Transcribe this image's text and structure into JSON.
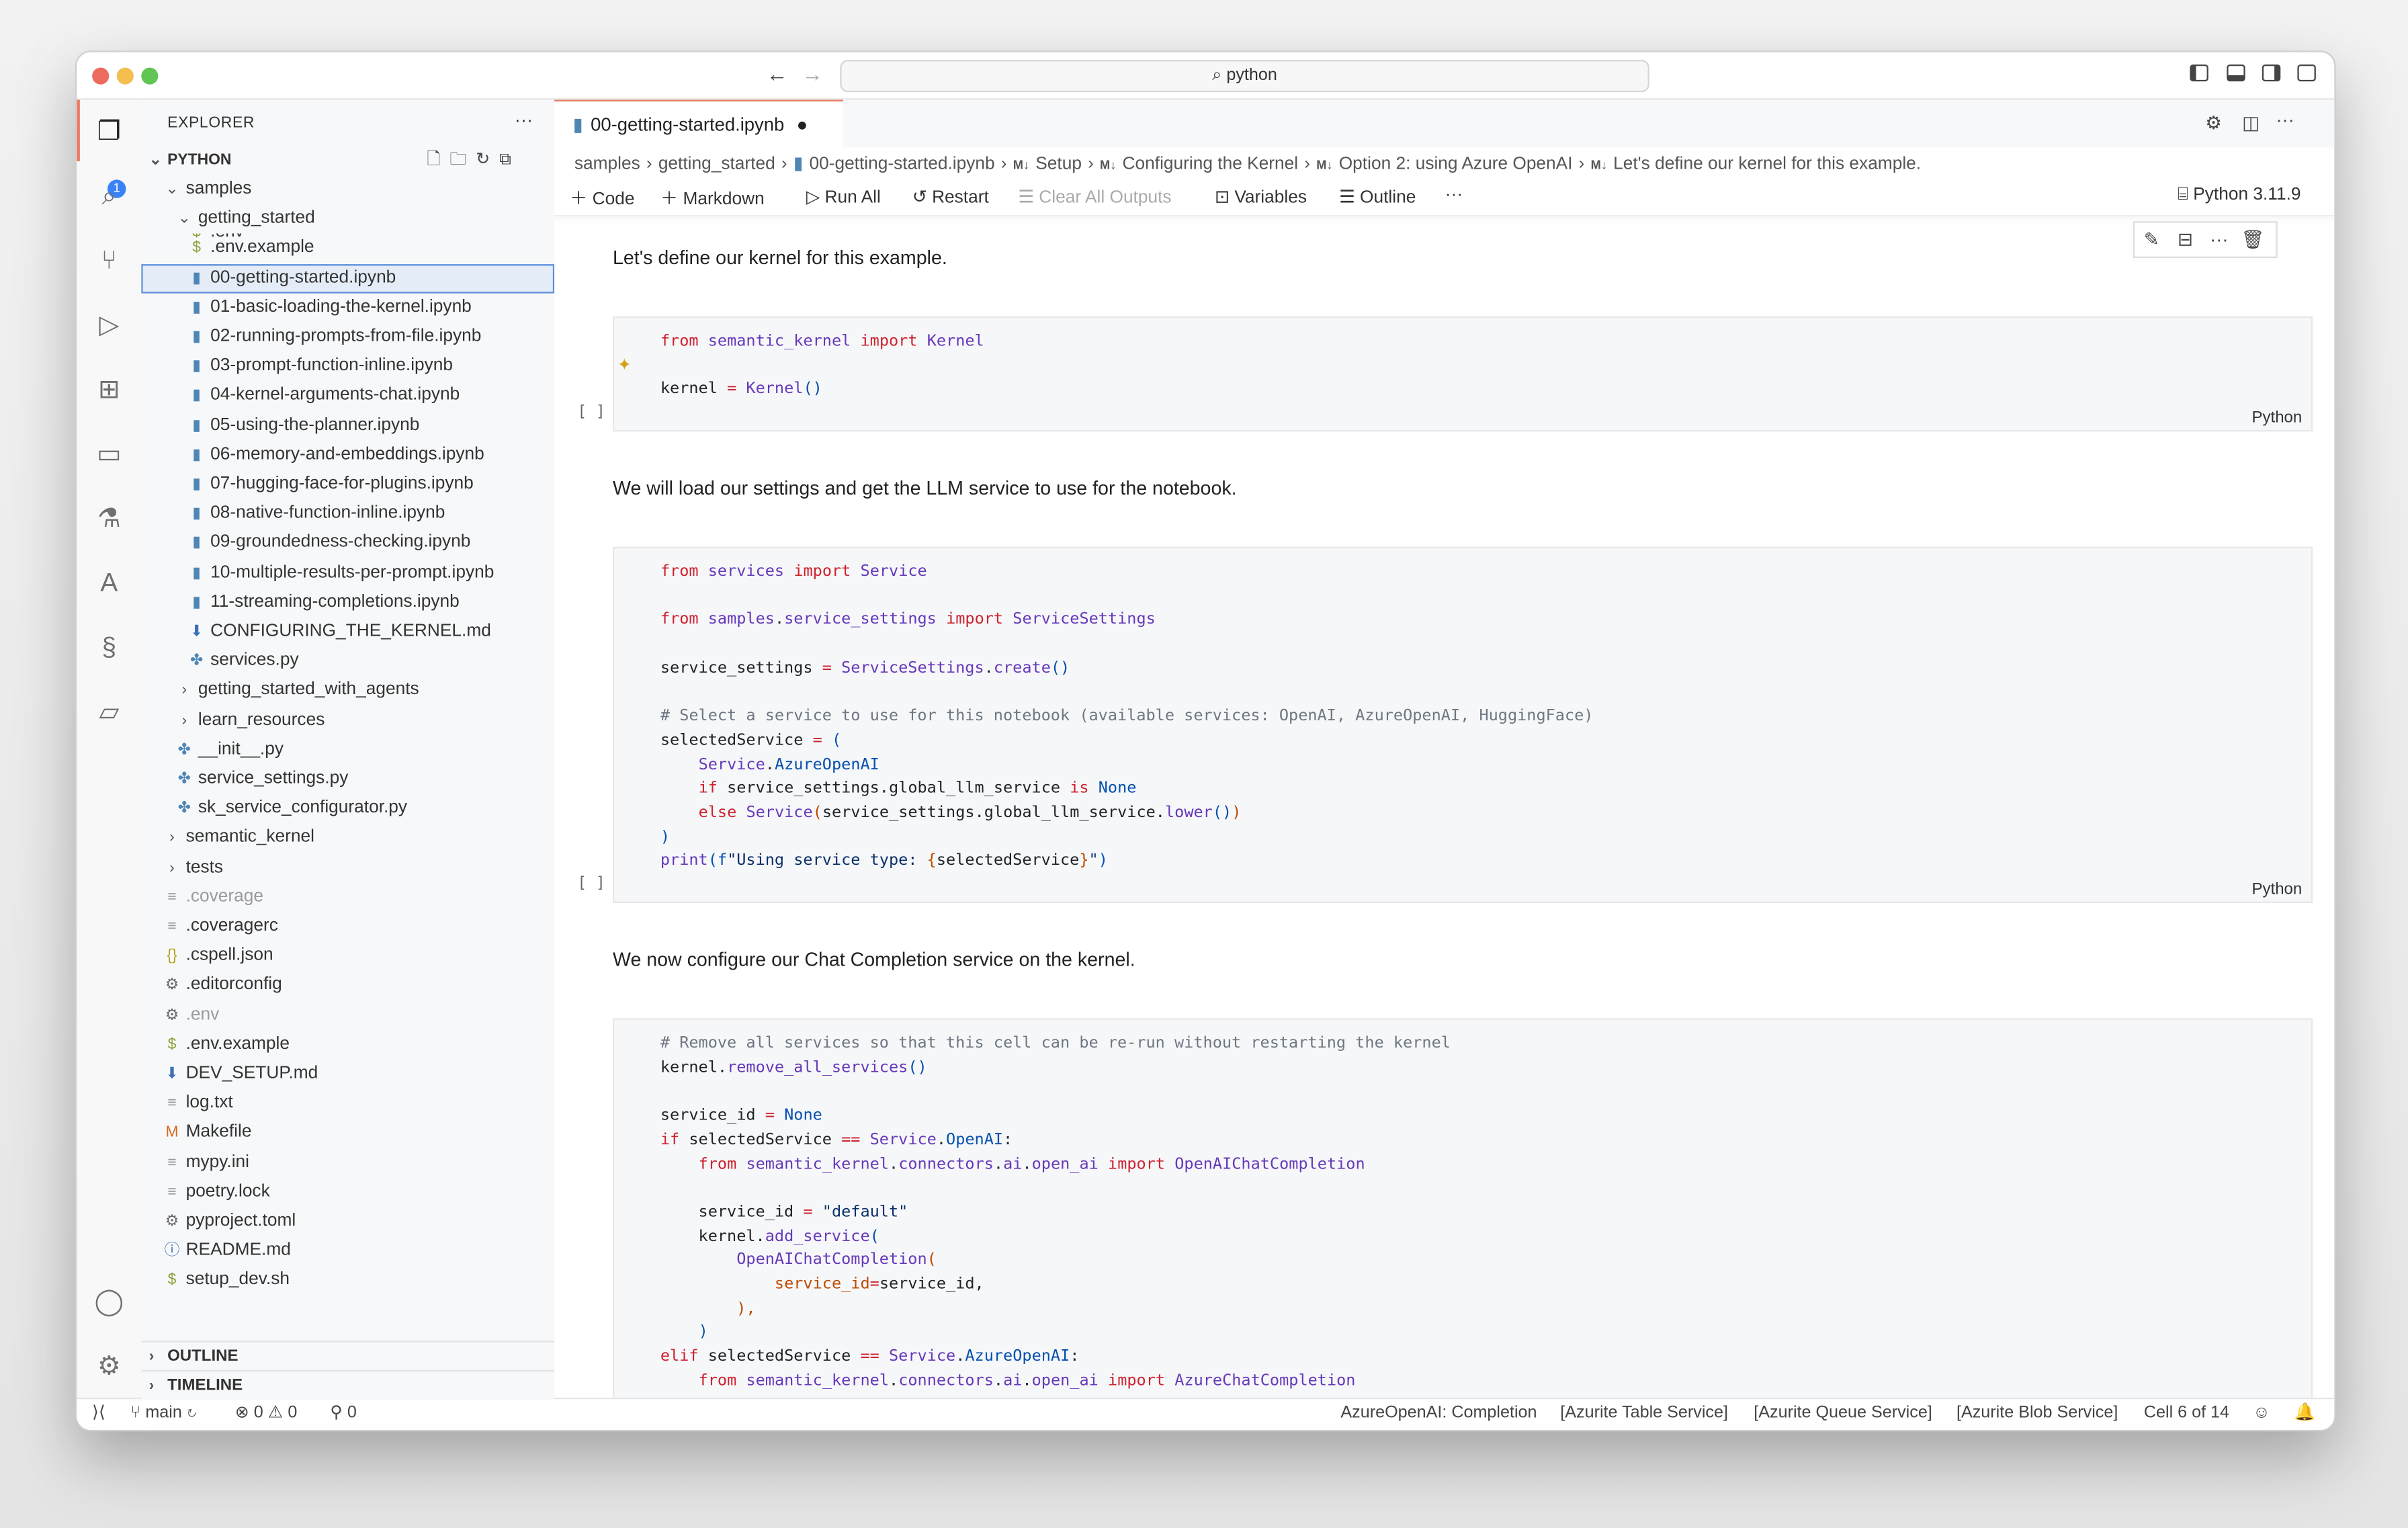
{
  "titlebar": {
    "search_text": "python",
    "search_icon": "search-icon"
  },
  "activity": {
    "explorer_badge": "1"
  },
  "explorer": {
    "title": "EXPLORER",
    "more": "···",
    "workspace": "PYTHON",
    "tree": [
      {
        "depth": 1,
        "kind": "folder-open",
        "label": "samples",
        "sticky": true
      },
      {
        "depth": 2,
        "kind": "folder-open",
        "label": "getting_started",
        "sticky": true
      },
      {
        "depth": 3,
        "kind": "env",
        "label": ".env"
      },
      {
        "depth": 3,
        "kind": "env",
        "label": ".env.example"
      },
      {
        "depth": 3,
        "kind": "nb",
        "label": "00-getting-started.ipynb",
        "selected": true
      },
      {
        "depth": 3,
        "kind": "nb",
        "label": "01-basic-loading-the-kernel.ipynb"
      },
      {
        "depth": 3,
        "kind": "nb",
        "label": "02-running-prompts-from-file.ipynb"
      },
      {
        "depth": 3,
        "kind": "nb",
        "label": "03-prompt-function-inline.ipynb"
      },
      {
        "depth": 3,
        "kind": "nb",
        "label": "04-kernel-arguments-chat.ipynb"
      },
      {
        "depth": 3,
        "kind": "nb",
        "label": "05-using-the-planner.ipynb"
      },
      {
        "depth": 3,
        "kind": "nb",
        "label": "06-memory-and-embeddings.ipynb"
      },
      {
        "depth": 3,
        "kind": "nb",
        "label": "07-hugging-face-for-plugins.ipynb"
      },
      {
        "depth": 3,
        "kind": "nb",
        "label": "08-native-function-inline.ipynb"
      },
      {
        "depth": 3,
        "kind": "nb",
        "label": "09-groundedness-checking.ipynb"
      },
      {
        "depth": 3,
        "kind": "nb",
        "label": "10-multiple-results-per-prompt.ipynb"
      },
      {
        "depth": 3,
        "kind": "nb",
        "label": "11-streaming-completions.ipynb"
      },
      {
        "depth": 3,
        "kind": "md",
        "label": "CONFIGURING_THE_KERNEL.md"
      },
      {
        "depth": 3,
        "kind": "py",
        "label": "services.py"
      },
      {
        "depth": 2,
        "kind": "folder",
        "label": "getting_started_with_agents"
      },
      {
        "depth": 2,
        "kind": "folder",
        "label": "learn_resources"
      },
      {
        "depth": 2,
        "kind": "py",
        "label": "__init__.py"
      },
      {
        "depth": 2,
        "kind": "py",
        "label": "service_settings.py"
      },
      {
        "depth": 2,
        "kind": "py",
        "label": "sk_service_configurator.py"
      },
      {
        "depth": 1,
        "kind": "folder",
        "label": "semantic_kernel"
      },
      {
        "depth": 1,
        "kind": "folder",
        "label": "tests"
      },
      {
        "depth": 1,
        "kind": "txt",
        "label": ".coverage",
        "faded": true
      },
      {
        "depth": 1,
        "kind": "txt",
        "label": ".coveragerc"
      },
      {
        "depth": 1,
        "kind": "json",
        "label": ".cspell.json"
      },
      {
        "depth": 1,
        "kind": "gear",
        "label": ".editorconfig"
      },
      {
        "depth": 1,
        "kind": "gear",
        "label": ".env",
        "faded": true
      },
      {
        "depth": 1,
        "kind": "env",
        "label": ".env.example"
      },
      {
        "depth": 1,
        "kind": "md",
        "label": "DEV_SETUP.md"
      },
      {
        "depth": 1,
        "kind": "txt",
        "label": "log.txt"
      },
      {
        "depth": 1,
        "kind": "make",
        "label": "Makefile"
      },
      {
        "depth": 1,
        "kind": "txt",
        "label": "mypy.ini"
      },
      {
        "depth": 1,
        "kind": "txt",
        "label": "poetry.lock"
      },
      {
        "depth": 1,
        "kind": "gear",
        "label": "pyproject.toml"
      },
      {
        "depth": 1,
        "kind": "info",
        "label": "README.md"
      },
      {
        "depth": 1,
        "kind": "env",
        "label": "setup_dev.sh"
      }
    ],
    "outline": "OUTLINE",
    "timeline": "TIMELINE"
  },
  "editor": {
    "tab_label": "00-getting-started.ipynb",
    "breadcrumbs": [
      "samples",
      "getting_started",
      "00-getting-started.ipynb",
      "Setup",
      "Configuring the Kernel",
      "Option 2: using Azure OpenAI",
      "Let's define our kernel for this example."
    ],
    "toolbar": {
      "code": "Code",
      "markdown": "Markdown",
      "run_all": "Run All",
      "restart": "Restart",
      "clear_all": "Clear All Outputs",
      "variables": "Variables",
      "outline": "Outline",
      "more": "···",
      "kernel": "Python 3.11.9"
    },
    "cells": [
      {
        "type": "markdown",
        "text": "Let's define our kernel for this example."
      },
      {
        "type": "code",
        "language": "Python",
        "bracket": "[ ]",
        "lines": [
          [
            [
              "k",
              "from"
            ],
            [
              "p",
              " "
            ],
            [
              "f",
              "semantic_kernel"
            ],
            [
              "p",
              " "
            ],
            [
              "k",
              "import"
            ],
            [
              "p",
              " "
            ],
            [
              "f",
              "Kernel"
            ]
          ],
          [],
          [
            [
              "p",
              "kernel "
            ],
            [
              "k",
              "="
            ],
            [
              "p",
              " "
            ],
            [
              "f",
              "Kernel"
            ],
            [
              "b",
              "()"
            ]
          ]
        ]
      },
      {
        "type": "markdown",
        "text": "We will load our settings and get the LLM service to use for the notebook."
      },
      {
        "type": "code",
        "language": "Python",
        "bracket": "[ ]",
        "lines": [
          [
            [
              "k",
              "from"
            ],
            [
              "p",
              " "
            ],
            [
              "f",
              "services"
            ],
            [
              "p",
              " "
            ],
            [
              "k",
              "import"
            ],
            [
              "p",
              " "
            ],
            [
              "f",
              "Service"
            ]
          ],
          [],
          [
            [
              "k",
              "from"
            ],
            [
              "p",
              " "
            ],
            [
              "f",
              "samples"
            ],
            [
              "p",
              "."
            ],
            [
              "f",
              "service_settings"
            ],
            [
              "p",
              " "
            ],
            [
              "k",
              "import"
            ],
            [
              "p",
              " "
            ],
            [
              "f",
              "ServiceSettings"
            ]
          ],
          [],
          [
            [
              "p",
              "service_settings "
            ],
            [
              "k",
              "="
            ],
            [
              "p",
              " "
            ],
            [
              "f",
              "ServiceSettings"
            ],
            [
              "p",
              "."
            ],
            [
              "f",
              "create"
            ],
            [
              "b",
              "()"
            ]
          ],
          [],
          [
            [
              "c",
              "# Select a service to use for this notebook (available services: OpenAI, AzureOpenAI, HuggingFace)"
            ]
          ],
          [
            [
              "p",
              "selectedService "
            ],
            [
              "k",
              "="
            ],
            [
              "p",
              " "
            ],
            [
              "b",
              "("
            ]
          ],
          [
            [
              "p",
              "    "
            ],
            [
              "f",
              "Service"
            ],
            [
              "p",
              "."
            ],
            [
              "b",
              "AzureOpenAI"
            ]
          ],
          [
            [
              "p",
              "    "
            ],
            [
              "k",
              "if"
            ],
            [
              "p",
              " service_settings.global_llm_service "
            ],
            [
              "k",
              "is"
            ],
            [
              "p",
              " "
            ],
            [
              "b",
              "None"
            ]
          ],
          [
            [
              "p",
              "    "
            ],
            [
              "k",
              "else"
            ],
            [
              "p",
              " "
            ],
            [
              "f",
              "Service"
            ],
            [
              "o",
              "("
            ],
            [
              "p",
              "service_settings.global_llm_service."
            ],
            [
              "f",
              "lower"
            ],
            [
              "b",
              "()"
            ],
            [
              "o",
              ")"
            ]
          ],
          [
            [
              "b",
              ")"
            ]
          ],
          [
            [
              "f",
              "print"
            ],
            [
              "b",
              "("
            ],
            [
              "b",
              "f"
            ],
            [
              "s",
              "\"Using service type: "
            ],
            [
              "o",
              "{"
            ],
            [
              "p",
              "selectedService"
            ],
            [
              "o",
              "}"
            ],
            [
              "s",
              "\""
            ],
            [
              "b",
              ")"
            ]
          ]
        ]
      },
      {
        "type": "markdown",
        "text": "We now configure our Chat Completion service on the kernel."
      },
      {
        "type": "code",
        "language": "Python",
        "bracket": "",
        "lines": [
          [
            [
              "c",
              "# Remove all services so that this cell can be re-run without restarting the kernel"
            ]
          ],
          [
            [
              "p",
              "kernel."
            ],
            [
              "f",
              "remove_all_services"
            ],
            [
              "b",
              "()"
            ]
          ],
          [],
          [
            [
              "p",
              "service_id "
            ],
            [
              "k",
              "="
            ],
            [
              "p",
              " "
            ],
            [
              "b",
              "None"
            ]
          ],
          [
            [
              "k",
              "if"
            ],
            [
              "p",
              " selectedService "
            ],
            [
              "k",
              "=="
            ],
            [
              "p",
              " "
            ],
            [
              "f",
              "Service"
            ],
            [
              "p",
              "."
            ],
            [
              "b",
              "OpenAI"
            ],
            [
              "p",
              ":"
            ]
          ],
          [
            [
              "p",
              "    "
            ],
            [
              "k",
              "from"
            ],
            [
              "p",
              " "
            ],
            [
              "f",
              "semantic_kernel"
            ],
            [
              "p",
              "."
            ],
            [
              "f",
              "connectors"
            ],
            [
              "p",
              "."
            ],
            [
              "f",
              "ai"
            ],
            [
              "p",
              "."
            ],
            [
              "f",
              "open_ai"
            ],
            [
              "p",
              " "
            ],
            [
              "k",
              "import"
            ],
            [
              "p",
              " "
            ],
            [
              "f",
              "OpenAIChatCompletion"
            ]
          ],
          [],
          [
            [
              "p",
              "    service_id "
            ],
            [
              "k",
              "="
            ],
            [
              "p",
              " "
            ],
            [
              "s",
              "\"default\""
            ]
          ],
          [
            [
              "p",
              "    kernel."
            ],
            [
              "f",
              "add_service"
            ],
            [
              "b",
              "("
            ]
          ],
          [
            [
              "p",
              "        "
            ],
            [
              "f",
              "OpenAIChatCompletion"
            ],
            [
              "o",
              "("
            ]
          ],
          [
            [
              "p",
              "            "
            ],
            [
              "o",
              "service_id"
            ],
            [
              "k",
              "="
            ],
            [
              "p",
              "service_id,"
            ]
          ],
          [
            [
              "p",
              "        "
            ],
            [
              "o",
              "),"
            ]
          ],
          [
            [
              "p",
              "    "
            ],
            [
              "b",
              ")"
            ]
          ],
          [
            [
              "k",
              "elif"
            ],
            [
              "p",
              " selectedService "
            ],
            [
              "k",
              "=="
            ],
            [
              "p",
              " "
            ],
            [
              "f",
              "Service"
            ],
            [
              "p",
              "."
            ],
            [
              "b",
              "AzureOpenAI"
            ],
            [
              "p",
              ":"
            ]
          ],
          [
            [
              "p",
              "    "
            ],
            [
              "k",
              "from"
            ],
            [
              "p",
              " "
            ],
            [
              "f",
              "semantic_kernel"
            ],
            [
              "p",
              "."
            ],
            [
              "f",
              "connectors"
            ],
            [
              "p",
              "."
            ],
            [
              "f",
              "ai"
            ],
            [
              "p",
              "."
            ],
            [
              "f",
              "open_ai"
            ],
            [
              "p",
              " "
            ],
            [
              "k",
              "import"
            ],
            [
              "p",
              " "
            ],
            [
              "f",
              "AzureChatCompletion"
            ]
          ]
        ]
      }
    ]
  },
  "statusbar": {
    "branch": "main",
    "errors": "0",
    "warnings": "0",
    "ports": "0",
    "items": [
      "AzureOpenAI: Completion",
      "[Azurite Table Service]",
      "[Azurite Queue Service]",
      "[Azurite Blob Service]",
      "Cell 6 of 14"
    ]
  },
  "colors": {
    "accent": "#e97a60",
    "selection": "#5b8fd9",
    "badge": "#3a82f6",
    "keyword": "#cf222e",
    "function": "#6639ba",
    "constant": "#0550ae"
  }
}
